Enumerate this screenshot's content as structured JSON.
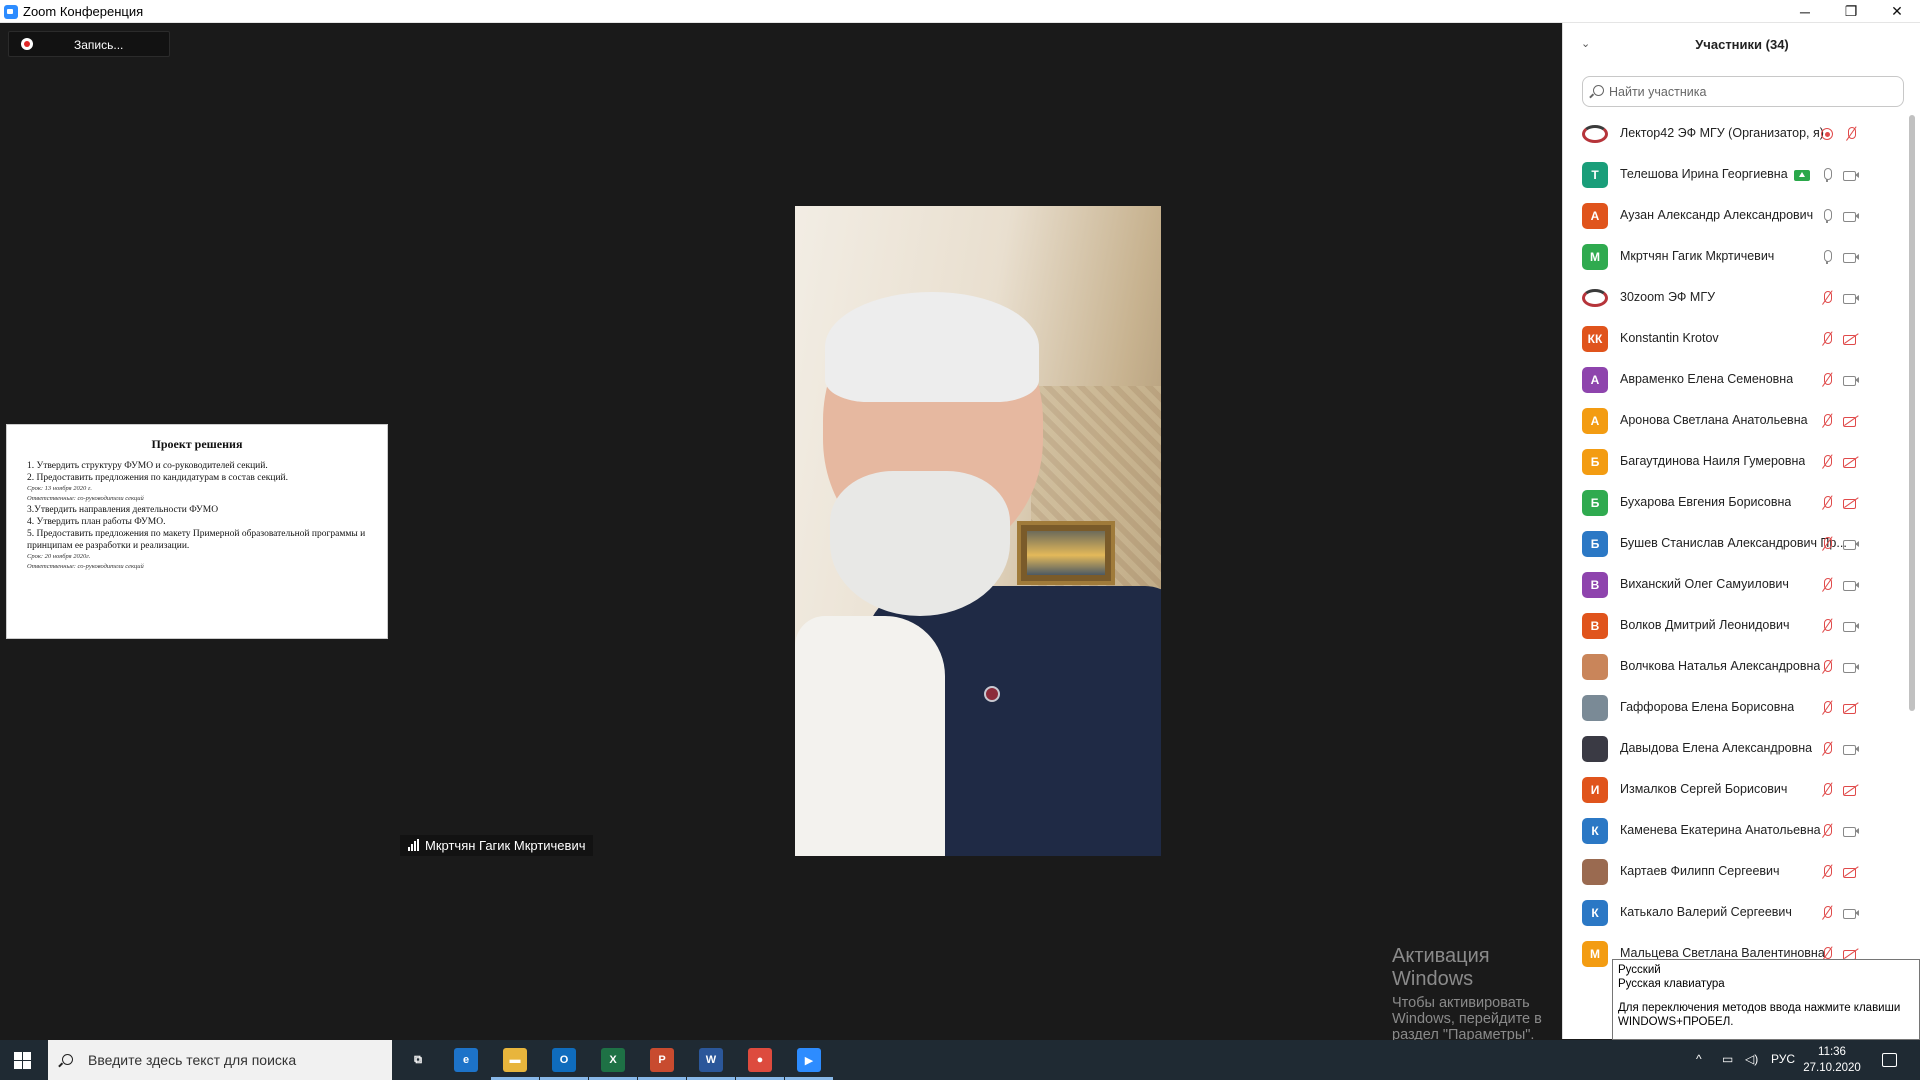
{
  "window": {
    "title": "Zoom Конференция",
    "min": "─",
    "max": "❐",
    "close": "✕"
  },
  "recording": {
    "label": "Запись..."
  },
  "slide": {
    "title": "Проект решения",
    "lines": [
      {
        "text": "1. Утвердить структуру ФУМО и со-руководителей секций.",
        "kind": "main"
      },
      {
        "text": "2. Предоставить предложения по кандидатурам в состав секций.",
        "kind": "main"
      },
      {
        "text": "Срок: 13 ноября 2020 г.",
        "kind": "sub"
      },
      {
        "text": "Ответственные: со-руководители секций",
        "kind": "sub"
      },
      {
        "text": "3.Утвердить направления деятельности ФУМО",
        "kind": "main"
      },
      {
        "text": "4. Утвердить план работы ФУМО.",
        "kind": "main"
      },
      {
        "text": "5. Предоставить предложения по макету Примерной образовательной программы и принципам ее разработки и реализации.",
        "kind": "main"
      },
      {
        "text": "Срок: 20 ноября 2020г.",
        "kind": "sub"
      },
      {
        "text": "Ответственные: со-руководители секций",
        "kind": "sub"
      }
    ]
  },
  "video": {
    "speaker_name": "Мкртчян Гагик Мкртичевич"
  },
  "watermark": {
    "title": "Активация Windows",
    "subtitle": "Чтобы активировать Windows, перейдите в раздел \"Параметры\"."
  },
  "participants": {
    "title": "Участники (34)",
    "search_placeholder": "Найти участника",
    "items": [
      {
        "name": "Лектор42 ЭФ МГУ (Организатор, я)",
        "initials": "",
        "avatar": "logo",
        "color": "#ffffff",
        "mic": "rec",
        "cam": "mic-muted"
      },
      {
        "name": "Телешова Ирина Георгиевна",
        "initials": "Т",
        "avatar": "letter",
        "color": "#1a9e7a",
        "mic": "on",
        "cam": "on",
        "sharing": true
      },
      {
        "name": "Аузан Александр Александрович",
        "initials": "А",
        "avatar": "letter",
        "color": "#e0541c",
        "mic": "on",
        "cam": "on"
      },
      {
        "name": "Мкртчян Гагик Мкртичевич",
        "initials": "М",
        "avatar": "letter",
        "color": "#2faa4f",
        "mic": "on",
        "cam": "on"
      },
      {
        "name": "30zoom ЭФ МГУ",
        "initials": "",
        "avatar": "logo",
        "color": "#ffffff",
        "mic": "muted",
        "cam": "on"
      },
      {
        "name": "Konstantin Krotov",
        "initials": "КК",
        "avatar": "letter",
        "color": "#e0541c",
        "mic": "muted",
        "cam": "off"
      },
      {
        "name": "Авраменко Елена Семеновна",
        "initials": "А",
        "avatar": "letter",
        "color": "#8e44ad",
        "mic": "muted",
        "cam": "on"
      },
      {
        "name": "Аронова Светлана Анатольевна",
        "initials": "А",
        "avatar": "letter",
        "color": "#f39c12",
        "mic": "muted",
        "cam": "off"
      },
      {
        "name": "Багаутдинова Наиля Гумеровна",
        "initials": "Б",
        "avatar": "letter",
        "color": "#f39c12",
        "mic": "muted",
        "cam": "off"
      },
      {
        "name": "Бухарова Евгения Борисовна",
        "initials": "Б",
        "avatar": "letter",
        "color": "#2faa4f",
        "mic": "muted",
        "cam": "off"
      },
      {
        "name": "Бушев Станислав Александрович Пр...",
        "initials": "Б",
        "avatar": "letter",
        "color": "#2b78c5",
        "mic": "muted",
        "cam": "on"
      },
      {
        "name": "Виханский Олег Самуилович",
        "initials": "В",
        "avatar": "letter",
        "color": "#8e44ad",
        "mic": "muted",
        "cam": "on"
      },
      {
        "name": "Волков Дмитрий Леонидович",
        "initials": "В",
        "avatar": "letter",
        "color": "#e0541c",
        "mic": "muted",
        "cam": "on"
      },
      {
        "name": "Волчкова Наталья Александровна",
        "initials": "",
        "avatar": "photo",
        "color": "#c9855a",
        "mic": "muted",
        "cam": "on"
      },
      {
        "name": "Гаффорова Елена Борисовна",
        "initials": "",
        "avatar": "photo",
        "color": "#7a8a96",
        "mic": "muted",
        "cam": "off"
      },
      {
        "name": "Давыдова Елена Александровна",
        "initials": "",
        "avatar": "photo",
        "color": "#3a3a44",
        "mic": "muted",
        "cam": "on"
      },
      {
        "name": "Измалков Сергей Борисович",
        "initials": "И",
        "avatar": "letter",
        "color": "#e0541c",
        "mic": "muted",
        "cam": "off"
      },
      {
        "name": "Каменева Екатерина Анатольевна",
        "initials": "К",
        "avatar": "letter",
        "color": "#2b78c5",
        "mic": "muted",
        "cam": "on"
      },
      {
        "name": "Картаев Филипп Сергеевич",
        "initials": "",
        "avatar": "photo",
        "color": "#9a6a50",
        "mic": "muted",
        "cam": "off"
      },
      {
        "name": "Катькало Валерий Сергеевич",
        "initials": "К",
        "avatar": "letter",
        "color": "#2b78c5",
        "mic": "muted",
        "cam": "on"
      },
      {
        "name": "Мальцева Светлана Валентиновна",
        "initials": "М",
        "avatar": "letter",
        "color": "#f39c12",
        "mic": "muted",
        "cam": "off"
      }
    ]
  },
  "ime_tooltip": {
    "line1": "Русский",
    "line2": "Русская клавиатура",
    "line3": "Для переключения методов ввода нажмите клавиши",
    "line4": "WINDOWS+ПРОБЕЛ."
  },
  "taskbar": {
    "search_placeholder": "Введите здесь текст для поиска",
    "apps": [
      {
        "name": "task-view",
        "label": "⧉",
        "color": "transparent"
      },
      {
        "name": "edge",
        "label": "e",
        "color": "#1d73c9"
      },
      {
        "name": "explorer",
        "label": "▬",
        "color": "#e8b53c"
      },
      {
        "name": "outlook",
        "label": "O",
        "color": "#0f6cbd"
      },
      {
        "name": "excel",
        "label": "X",
        "color": "#1e7145"
      },
      {
        "name": "powerpoint",
        "label": "P",
        "color": "#c84b2f"
      },
      {
        "name": "word",
        "label": "W",
        "color": "#2b579a"
      },
      {
        "name": "chrome",
        "label": "●",
        "color": "#dd4b3e"
      },
      {
        "name": "zoom",
        "label": "▶",
        "color": "#2d8cff"
      }
    ],
    "lang": "РУС",
    "time": "11:36",
    "date": "27.10.2020",
    "tray_arrow": "^"
  }
}
